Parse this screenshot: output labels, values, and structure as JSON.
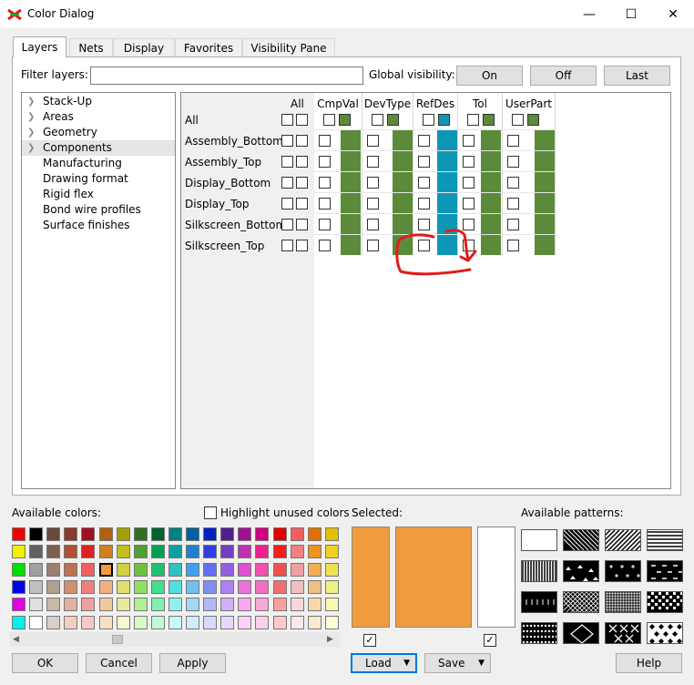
{
  "window": {
    "title": "Color Dialog",
    "minimize": "—",
    "maximize": "☐",
    "close": "✕"
  },
  "tabs": [
    "Layers",
    "Nets",
    "Display",
    "Favorites",
    "Visibility Pane"
  ],
  "filter": {
    "label": "Filter layers:",
    "value": ""
  },
  "global_visibility": {
    "label": "Global visibility:",
    "on": "On",
    "off": "Off",
    "last": "Last"
  },
  "tree": [
    "Stack-Up",
    "Areas",
    "Geometry",
    "Components",
    "Manufacturing",
    "Drawing format",
    "Rigid flex",
    "Bond wire profiles",
    "Surface finishes"
  ],
  "grid": {
    "all_label": "All",
    "columns": [
      "CmpVal",
      "DevType",
      "RefDes",
      "Tol",
      "UserPart"
    ],
    "rows": [
      "All",
      "Assembly_Bottom",
      "Assembly_Top",
      "Display_Bottom",
      "Display_Top",
      "Silkscreen_Bottom",
      "Silkscreen_Top"
    ]
  },
  "colors": {
    "green": "#5b8a3a",
    "teal": "#0e97b5",
    "orange": "#f09c3e",
    "annotation_red": "#e21b1b"
  },
  "available_colors_label": "Available colors:",
  "highlight_unused": "Highlight unused colors",
  "selected_label": "Selected:",
  "available_patterns_label": "Available patterns:",
  "buttons": {
    "ok": "OK",
    "cancel": "Cancel",
    "apply": "Apply",
    "load": "Load",
    "save": "Save",
    "help": "Help"
  },
  "palette_rows": [
    [
      "#f00000",
      "#000000",
      "#6a4a3a",
      "#8a3a2a",
      "#a01020",
      "#b06010",
      "#a0a000",
      "#307020",
      "#006030",
      "#008080",
      "#0060a0",
      "#0020c0",
      "#502090",
      "#a01090",
      "#d00080",
      "#e00000",
      "#f06060",
      "#e07000",
      "#e0c000"
    ],
    [
      "#f0f000",
      "#606060",
      "#7a6050",
      "#b05030",
      "#e02020",
      "#d08020",
      "#c0c020",
      "#50a030",
      "#00a050",
      "#10a0a0",
      "#2080d0",
      "#3040e0",
      "#7040c0",
      "#c030b0",
      "#f02090",
      "#f02020",
      "#f08080",
      "#f09020",
      "#f0d020"
    ],
    [
      "#00e000",
      "#a0a0a0",
      "#9a8070",
      "#c07050",
      "#f06060",
      "#f09c3e",
      "#d0d040",
      "#70c040",
      "#20c070",
      "#30c0c0",
      "#40a0f0",
      "#6070f0",
      "#9060e0",
      "#e050d0",
      "#f050b0",
      "#f05050",
      "#f0a0a0",
      "#f0b050",
      "#f0e050"
    ],
    [
      "#0000f0",
      "#c0c0c0",
      "#b0a090",
      "#d09070",
      "#f08080",
      "#f0b080",
      "#e0e070",
      "#90e060",
      "#40e090",
      "#50e0e0",
      "#70c0f0",
      "#8090f0",
      "#b080f0",
      "#f070e0",
      "#f070c0",
      "#f07070",
      "#f0c0c0",
      "#f0c080",
      "#f0f080"
    ],
    [
      "#e000e0",
      "#e0e0e0",
      "#c8b8a8",
      "#e0b0a0",
      "#f0a0a0",
      "#f0c8a0",
      "#e8e8a0",
      "#b0f090",
      "#80f0b0",
      "#90f0f0",
      "#a0d8f8",
      "#b0b8f8",
      "#d0b0f8",
      "#f8a8f0",
      "#f8a8d8",
      "#f8a0a0",
      "#f8d8d8",
      "#f8d8a8",
      "#f8f8b0"
    ],
    [
      "#00f0f0",
      "#ffffff",
      "#d8d0c8",
      "#f0d0c0",
      "#f8c8c8",
      "#f8e0c8",
      "#f8f8d0",
      "#d8f8c8",
      "#c0f8d8",
      "#c8f8f8",
      "#d0ecfc",
      "#d8dcfc",
      "#e8d8fc",
      "#fcd0f8",
      "#fcd0e8",
      "#fcc8c8",
      "#fce8e8",
      "#fce8d0",
      "#fcfcd8"
    ]
  ]
}
